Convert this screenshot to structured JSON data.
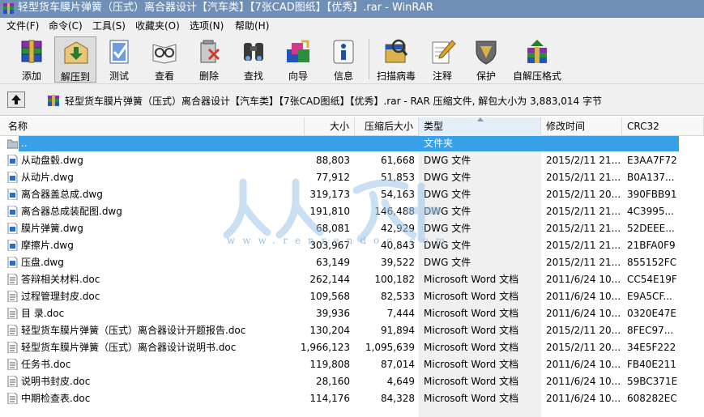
{
  "window": {
    "title": "轻型货车膜片弹簧（压式）离合器设计【汽车类】【7张CAD图纸】【优秀】.rar - WinRAR"
  },
  "menu": [
    "文件(F)",
    "命令(C)",
    "工具(S)",
    "收藏夹(O)",
    "选项(N)",
    "帮助(H)"
  ],
  "toolbar": {
    "buttons": [
      {
        "label": "添加",
        "icon": "add-archive-icon"
      },
      {
        "label": "解压到",
        "icon": "extract-to-icon"
      },
      {
        "label": "测试",
        "icon": "test-icon"
      },
      {
        "label": "查看",
        "icon": "view-icon"
      },
      {
        "label": "删除",
        "icon": "delete-icon"
      },
      {
        "label": "查找",
        "icon": "find-icon"
      },
      {
        "label": "向导",
        "icon": "wizard-icon"
      },
      {
        "label": "信息",
        "icon": "info-icon"
      },
      {
        "label": "扫描病毒",
        "icon": "scan-virus-icon"
      },
      {
        "label": "注释",
        "icon": "comment-icon"
      },
      {
        "label": "保护",
        "icon": "protect-icon"
      },
      {
        "label": "自解压格式",
        "icon": "sfx-icon"
      }
    ]
  },
  "address": {
    "text": "轻型货车膜片弹簧（压式）离合器设计【汽车类】【7张CAD图纸】【优秀】.rar - RAR 压缩文件, 解包大小为 3,883,014 字节"
  },
  "columns": {
    "name": "名称",
    "size": "大小",
    "packed": "压缩后大小",
    "type": "类型",
    "modified": "修改时间",
    "crc": "CRC32"
  },
  "watermark": {
    "text": "www.renrendoc.com",
    "glyphs": "人人文库"
  },
  "files": [
    {
      "name": "..",
      "size": "",
      "packed": "",
      "type": "文件夹",
      "modified": "",
      "crc": "",
      "icon": "parent-folder-icon"
    },
    {
      "name": "从动盘毂.dwg",
      "size": "88,803",
      "packed": "61,668",
      "type": "DWG 文件",
      "modified": "2015/2/11 21...",
      "crc": "E3AA7F72",
      "icon": "dwg-file-icon"
    },
    {
      "name": "从动片.dwg",
      "size": "77,912",
      "packed": "51,853",
      "type": "DWG 文件",
      "modified": "2015/2/11 21...",
      "crc": "B0A137...",
      "icon": "dwg-file-icon"
    },
    {
      "name": "离合器盖总成.dwg",
      "size": "319,173",
      "packed": "54,163",
      "type": "DWG 文件",
      "modified": "2015/2/11 20...",
      "crc": "390FBB91",
      "icon": "dwg-file-icon"
    },
    {
      "name": "离合器总成装配图.dwg",
      "size": "191,810",
      "packed": "146,488",
      "type": "DWG 文件",
      "modified": "2015/2/11 21...",
      "crc": "4C3995...",
      "icon": "dwg-file-icon"
    },
    {
      "name": "膜片弹簧.dwg",
      "size": "68,081",
      "packed": "42,929",
      "type": "DWG 文件",
      "modified": "2015/2/11 21...",
      "crc": "52DEEE...",
      "icon": "dwg-file-icon"
    },
    {
      "name": "摩擦片.dwg",
      "size": "303,967",
      "packed": "40,843",
      "type": "DWG 文件",
      "modified": "2015/2/11 21...",
      "crc": "21BFA0F9",
      "icon": "dwg-file-icon"
    },
    {
      "name": "压盘.dwg",
      "size": "63,149",
      "packed": "39,522",
      "type": "DWG 文件",
      "modified": "2015/2/11 21...",
      "crc": "855152FC",
      "icon": "dwg-file-icon"
    },
    {
      "name": "答辩相关材料.doc",
      "size": "262,144",
      "packed": "100,182",
      "type": "Microsoft Word 文档",
      "modified": "2011/6/24 10...",
      "crc": "CC54E19F",
      "icon": "doc-file-icon"
    },
    {
      "name": "过程管理封皮.doc",
      "size": "109,568",
      "packed": "82,533",
      "type": "Microsoft Word 文档",
      "modified": "2011/6/24 10...",
      "crc": "E9A5CF...",
      "icon": "doc-file-icon"
    },
    {
      "name": "目  录.doc",
      "size": "39,936",
      "packed": "7,444",
      "type": "Microsoft Word 文档",
      "modified": "2011/6/24 10...",
      "crc": "0320E47E",
      "icon": "doc-file-icon"
    },
    {
      "name": "轻型货车膜片弹簧（压式）离合器设计开题报告.doc",
      "size": "130,204",
      "packed": "91,894",
      "type": "Microsoft Word 文档",
      "modified": "2015/2/11 20...",
      "crc": "8FEC97...",
      "icon": "doc-file-icon"
    },
    {
      "name": "轻型货车膜片弹簧（压式）离合器设计说明书.doc",
      "size": "1,966,123",
      "packed": "1,095,639",
      "type": "Microsoft Word 文档",
      "modified": "2015/2/11 20...",
      "crc": "34E5F222",
      "icon": "doc-file-icon"
    },
    {
      "name": "任务书.doc",
      "size": "119,808",
      "packed": "87,014",
      "type": "Microsoft Word 文档",
      "modified": "2011/6/24 10...",
      "crc": "FB40E211",
      "icon": "doc-file-icon"
    },
    {
      "name": "说明书封皮.doc",
      "size": "28,160",
      "packed": "4,649",
      "type": "Microsoft Word 文档",
      "modified": "2011/6/24 10...",
      "crc": "59BC371E",
      "icon": "doc-file-icon"
    },
    {
      "name": "中期检查表.doc",
      "size": "114,176",
      "packed": "84,328",
      "type": "Microsoft Word 文档",
      "modified": "2011/6/24 10...",
      "crc": "608282EC",
      "icon": "doc-file-icon"
    }
  ],
  "selected_index": 0,
  "colors": {
    "titlebar": "#6f8fb6",
    "selection": "#38a0e6",
    "sorted_column": "#f0f0f0"
  }
}
